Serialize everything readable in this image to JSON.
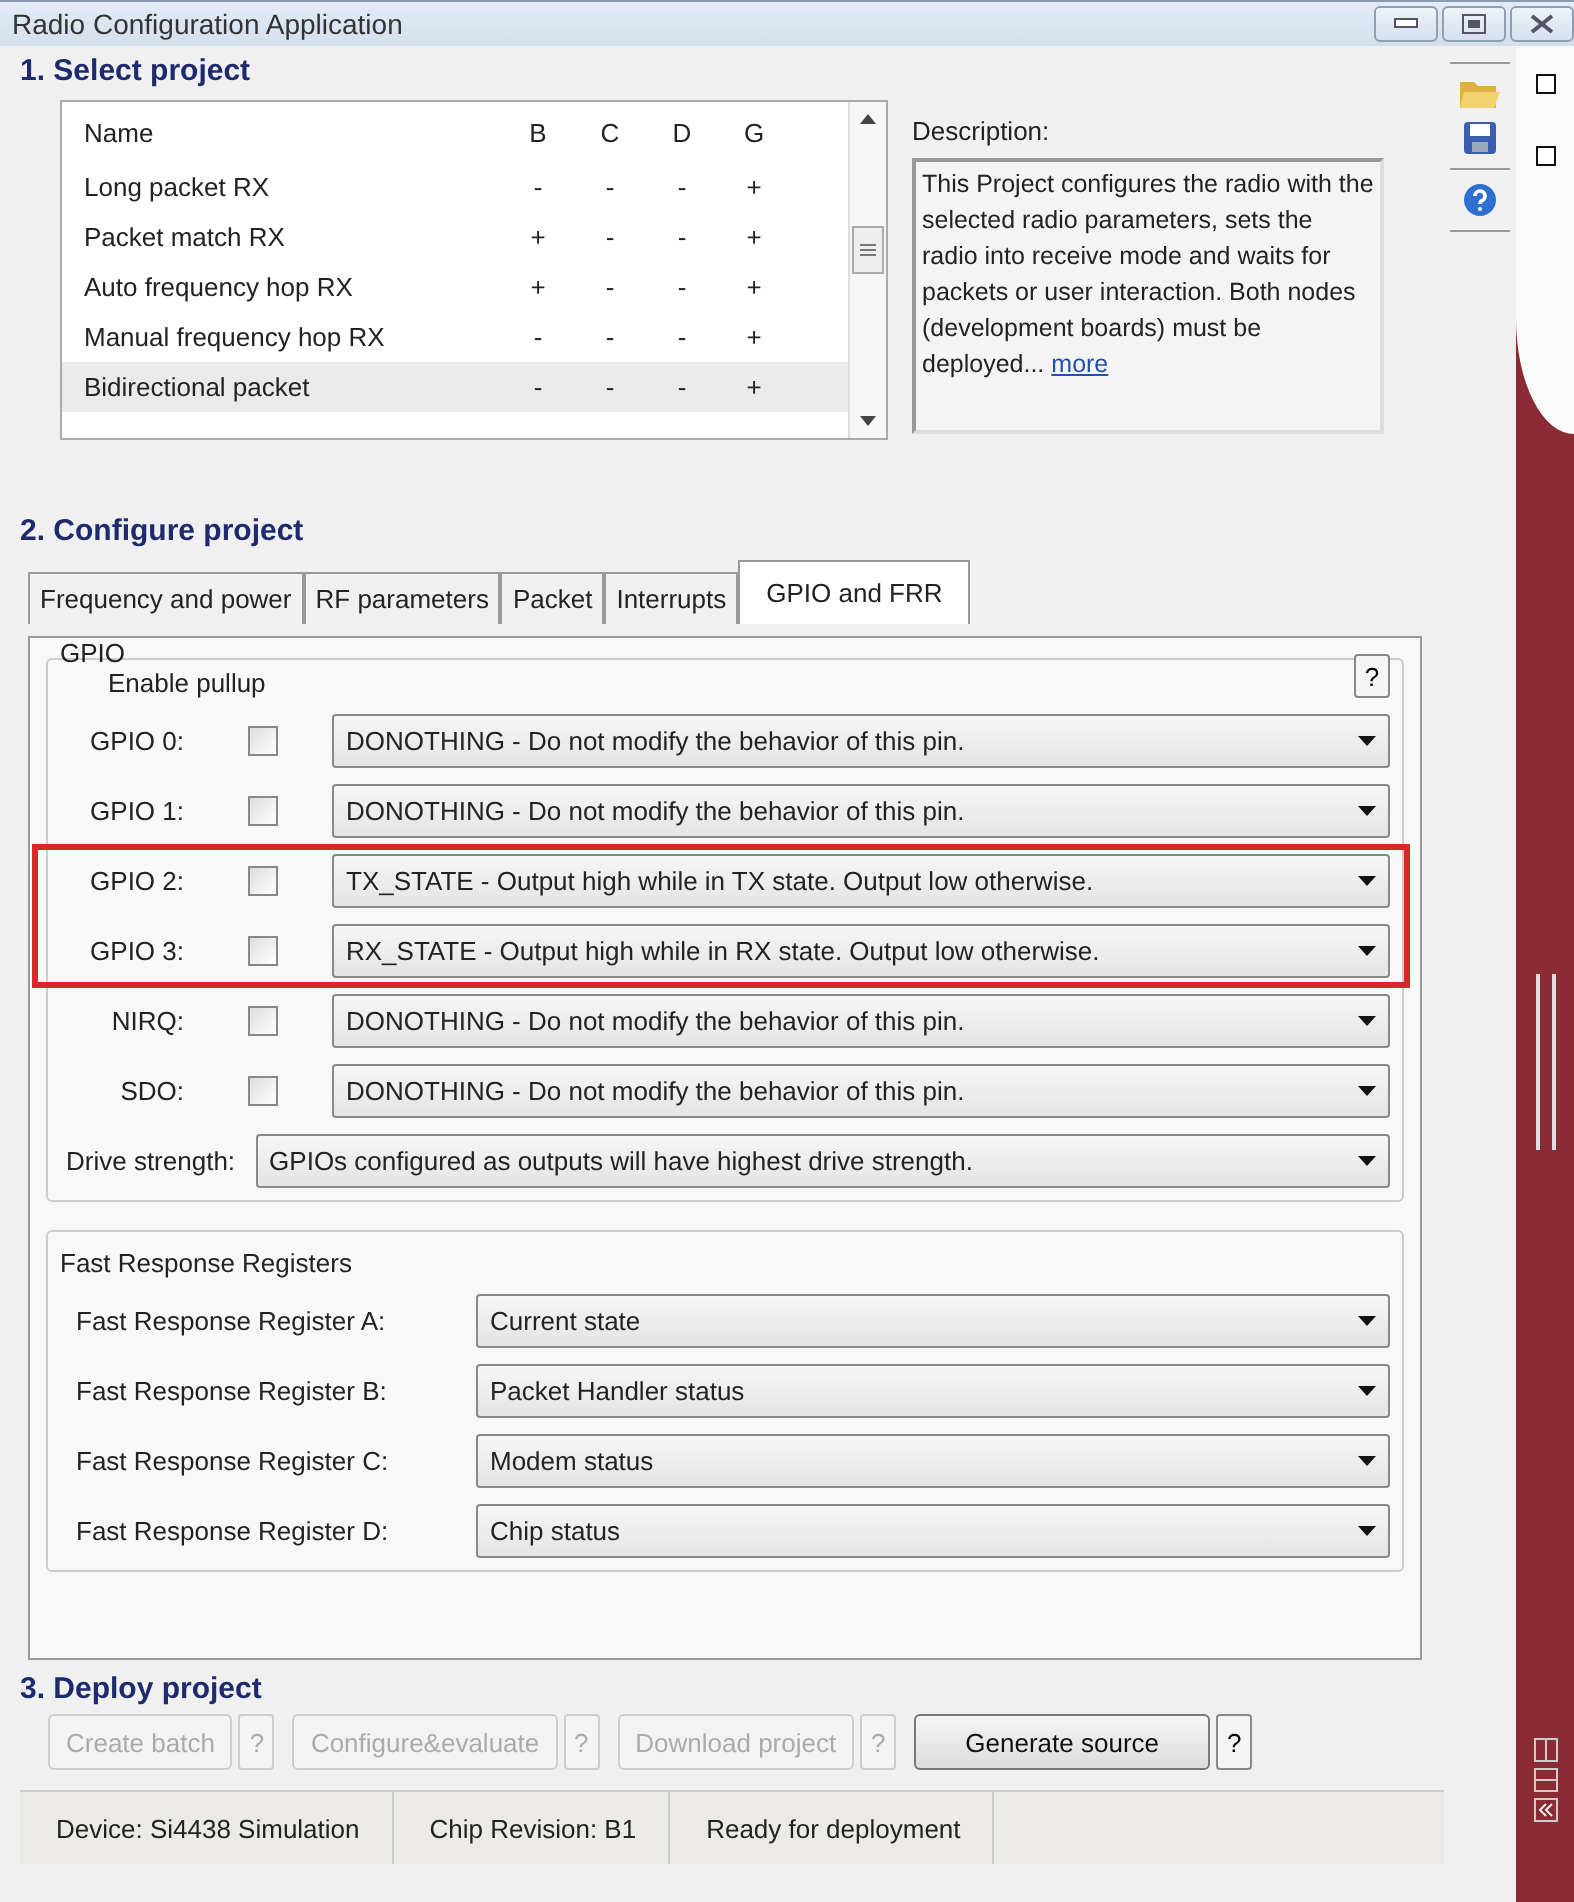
{
  "window": {
    "title": "Radio Configuration Application"
  },
  "select_project": {
    "heading": "1. Select project",
    "columns": [
      "Name",
      "B",
      "C",
      "D",
      "G"
    ],
    "rows": [
      {
        "cells": [
          "Long packet RX",
          "-",
          "-",
          "-",
          "+"
        ],
        "selected": false
      },
      {
        "cells": [
          "Packet match RX",
          "+",
          "-",
          "-",
          "+"
        ],
        "selected": false
      },
      {
        "cells": [
          "Auto frequency hop RX",
          "+",
          "-",
          "-",
          "+"
        ],
        "selected": false
      },
      {
        "cells": [
          "Manual frequency hop RX",
          "-",
          "-",
          "-",
          "+"
        ],
        "selected": false
      },
      {
        "cells": [
          "Bidirectional packet",
          "-",
          "-",
          "-",
          "+"
        ],
        "selected": true
      }
    ],
    "description_label": "Description:",
    "description": "This Project configures the radio with the selected radio parameters, sets the radio into receive mode and waits for packets or user interaction. Both nodes (development boards) must be deployed...",
    "more_link": "more"
  },
  "configure_project": {
    "heading": "2. Configure project",
    "tabs": [
      {
        "label": "Frequency and power",
        "selected": false
      },
      {
        "label": "RF parameters",
        "selected": false
      },
      {
        "label": "Packet",
        "selected": false
      },
      {
        "label": "Interrupts",
        "selected": false
      },
      {
        "label": "GPIO and FRR",
        "selected": true
      }
    ],
    "gpio": {
      "title": "GPIO",
      "enable_pullup": "Enable pullup",
      "help": "?",
      "pins": [
        {
          "label": "GPIO 0:",
          "pullup": false,
          "value": "DONOTHING - Do not modify the behavior of this pin.",
          "highlighted": false
        },
        {
          "label": "GPIO 1:",
          "pullup": false,
          "value": "DONOTHING - Do not modify the behavior of this pin.",
          "highlighted": false
        },
        {
          "label": "GPIO 2:",
          "pullup": false,
          "value": "TX_STATE - Output high while in TX state. Output low otherwise.",
          "highlighted": true
        },
        {
          "label": "GPIO 3:",
          "pullup": false,
          "value": "RX_STATE - Output high while in RX state. Output low otherwise.",
          "highlighted": true
        },
        {
          "label": "NIRQ:",
          "pullup": false,
          "value": "DONOTHING - Do not modify the behavior of this pin.",
          "highlighted": false
        },
        {
          "label": "SDO:",
          "pullup": false,
          "value": "DONOTHING - Do not modify the behavior of this pin.",
          "highlighted": false
        }
      ],
      "drive_strength": {
        "label": "Drive strength:",
        "value": "GPIOs configured as outputs will have highest drive strength."
      }
    },
    "frr": {
      "title": "Fast Response Registers",
      "registers": [
        {
          "label": "Fast Response Register A:",
          "value": "Current state"
        },
        {
          "label": "Fast Response Register B:",
          "value": "Packet Handler status"
        },
        {
          "label": "Fast Response Register C:",
          "value": "Modem status"
        },
        {
          "label": "Fast Response Register D:",
          "value": "Chip status"
        }
      ]
    }
  },
  "deploy": {
    "heading": "3. Deploy project",
    "buttons": [
      {
        "label": "Create batch",
        "disabled": true,
        "help": "?"
      },
      {
        "label": "Configure&evaluate",
        "disabled": true,
        "help": "?"
      },
      {
        "label": "Download project",
        "disabled": true,
        "help": "?"
      },
      {
        "label": "Generate source",
        "disabled": false,
        "help": "?"
      }
    ]
  },
  "status_bar": [
    "Device: Si4438  Simulation",
    "Chip Revision: B1",
    "Ready for deployment"
  ]
}
